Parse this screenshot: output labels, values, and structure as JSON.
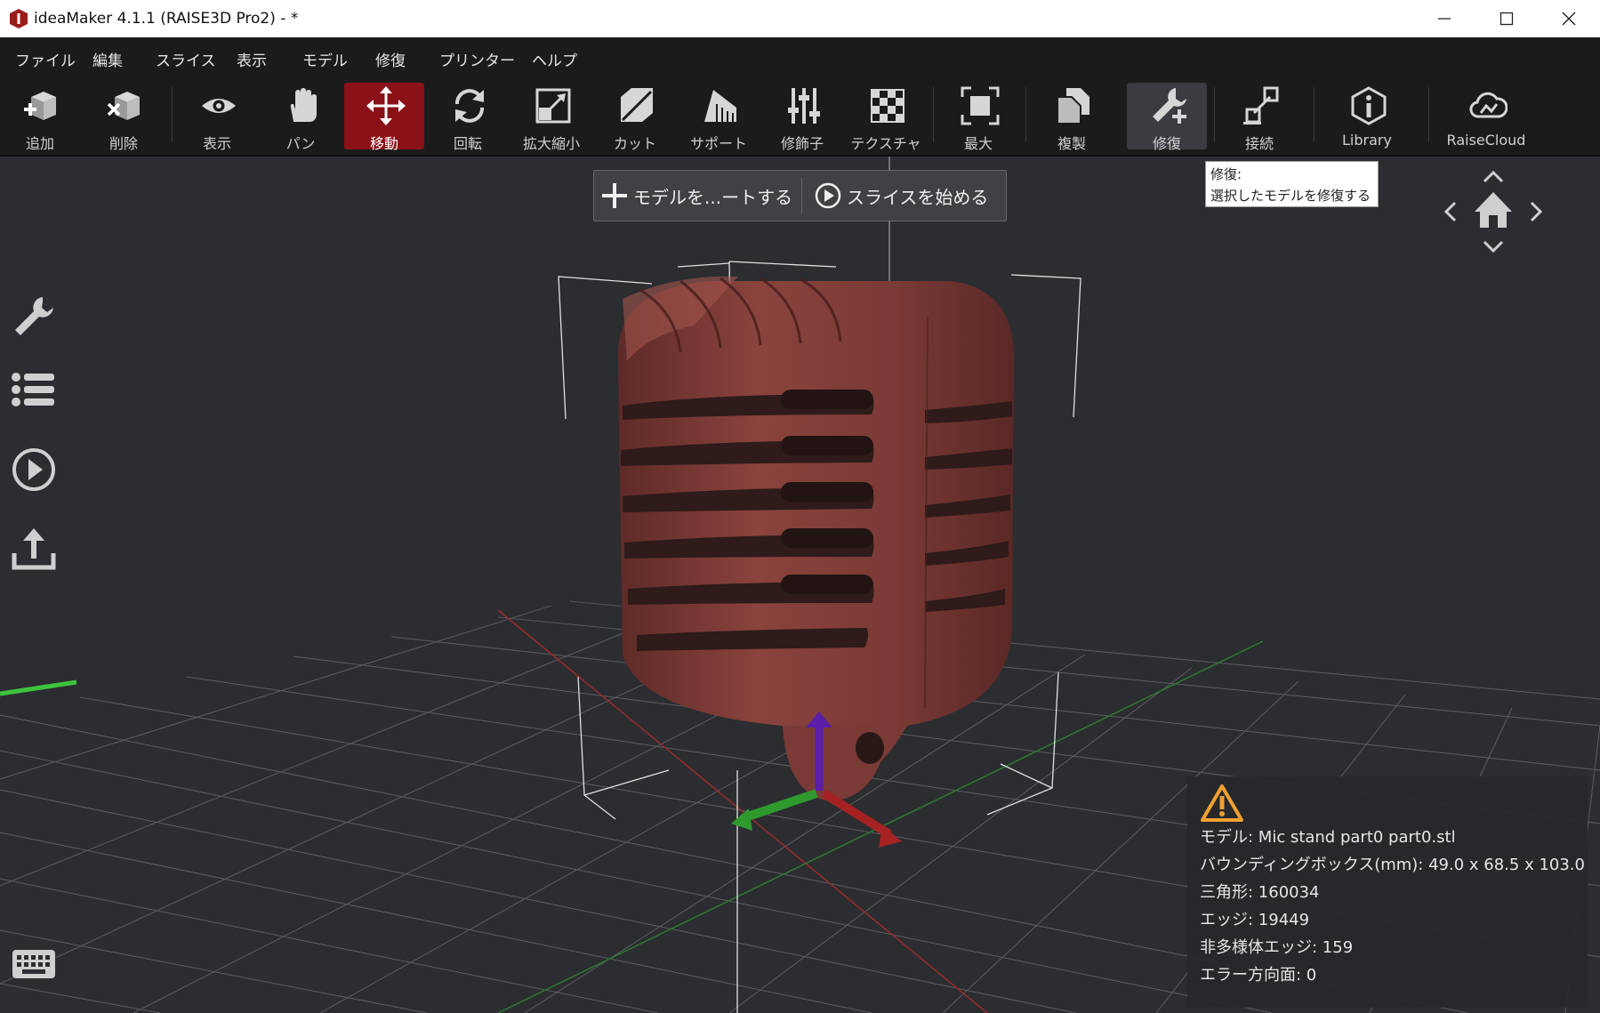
{
  "window": {
    "title": "ideaMaker 4.1.1 (RAISE3D Pro2) - *"
  },
  "menu": [
    "ファイル",
    "編集",
    "スライス",
    "表示",
    "モデル",
    "修復",
    "プリンター",
    "ヘルプ"
  ],
  "toolbar": {
    "add": "追加",
    "delete": "削除",
    "view": "表示",
    "pan": "パン",
    "move": "移動",
    "rotate": "回転",
    "scale": "拡大縮小",
    "cut": "カット",
    "support": "サポート",
    "modifier": "修飾子",
    "texture": "テクスチャ",
    "max": "最大",
    "duplicate": "複製",
    "repair": "修復",
    "connect": "接続",
    "library": "Library",
    "raisecloud": "RaiseCloud"
  },
  "quickbar": {
    "import": "モデルを...ートする",
    "slice": "スライスを始める"
  },
  "tooltip": {
    "title": "修復:",
    "body": "選択したモデルを修復する"
  },
  "info": {
    "model": "モデル: Mic stand part0 part0.stl",
    "bbox": "バウンディングボックス(mm): 49.0 x 68.5 x 103.0",
    "triangles": "三角形: 160034",
    "edges": "エッジ: 19449",
    "nonmanifold": "非多様体エッジ: 159",
    "error_faces": "エラー方向面: 0"
  },
  "colors": {
    "accent": "#8b1118",
    "model": "#7d3b36",
    "warning": "#f0a030"
  }
}
